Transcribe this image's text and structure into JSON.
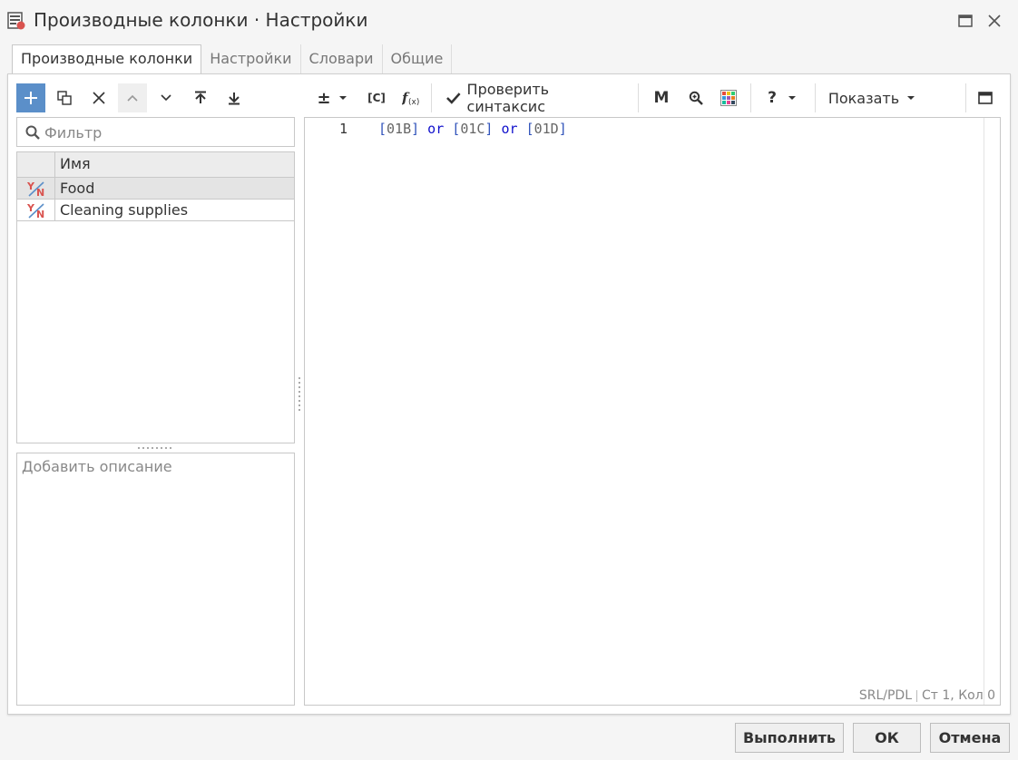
{
  "window": {
    "title": "Производные колонки · Настройки",
    "app_icon": "calculator-column-icon",
    "maximize_icon": "maximize-icon",
    "close_icon": "close-icon"
  },
  "tabs": [
    {
      "label": "Производные колонки",
      "active": true
    },
    {
      "label": "Настройки",
      "active": false
    },
    {
      "label": "Словари",
      "active": false
    },
    {
      "label": "Общие",
      "active": false
    }
  ],
  "left_toolbar": [
    "plus-icon",
    "duplicate-icon",
    "delete-icon",
    "move-up-icon",
    "move-down-icon",
    "move-top-icon",
    "move-bottom-icon"
  ],
  "editor_toolbar": {
    "plus_minus": "±",
    "column_ref": "[C]",
    "function_icon": "function-icon",
    "check_syntax_label": "Проверить синтаксис",
    "m_label": "M",
    "zoom_icon": "zoom-icon",
    "color_grid_icon": "color-grid-icon",
    "help_label": "?",
    "show_label": "Показать",
    "panel_icon": "panel-toggle-icon"
  },
  "filter": {
    "placeholder": "Фильтр",
    "value": ""
  },
  "grid": {
    "header": "Имя",
    "rows": [
      {
        "name": "Food",
        "selected": true
      },
      {
        "name": "Cleaning supplies",
        "selected": false
      }
    ]
  },
  "description": {
    "placeholder": "Добавить описание"
  },
  "editor": {
    "line_number": "1",
    "tokens": {
      "b1_open": "[",
      "b1_ref": "01B",
      "b1_close": "]",
      "op1": " or ",
      "b2_open": "[",
      "b2_ref": "01C",
      "b2_close": "]",
      "op2": " or ",
      "b3_open": "[",
      "b3_ref": "01D",
      "b3_close": "]"
    },
    "status_lang": "SRL/PDL",
    "status_pos": "Ст 1, Кол 0"
  },
  "buttons": {
    "run": "Выполнить",
    "ok": "ОК",
    "cancel": "Отмена"
  },
  "colors": {
    "accent": "#5b8fc9",
    "icon_red": "#d9534f",
    "code_keyword": "#1111cc"
  }
}
